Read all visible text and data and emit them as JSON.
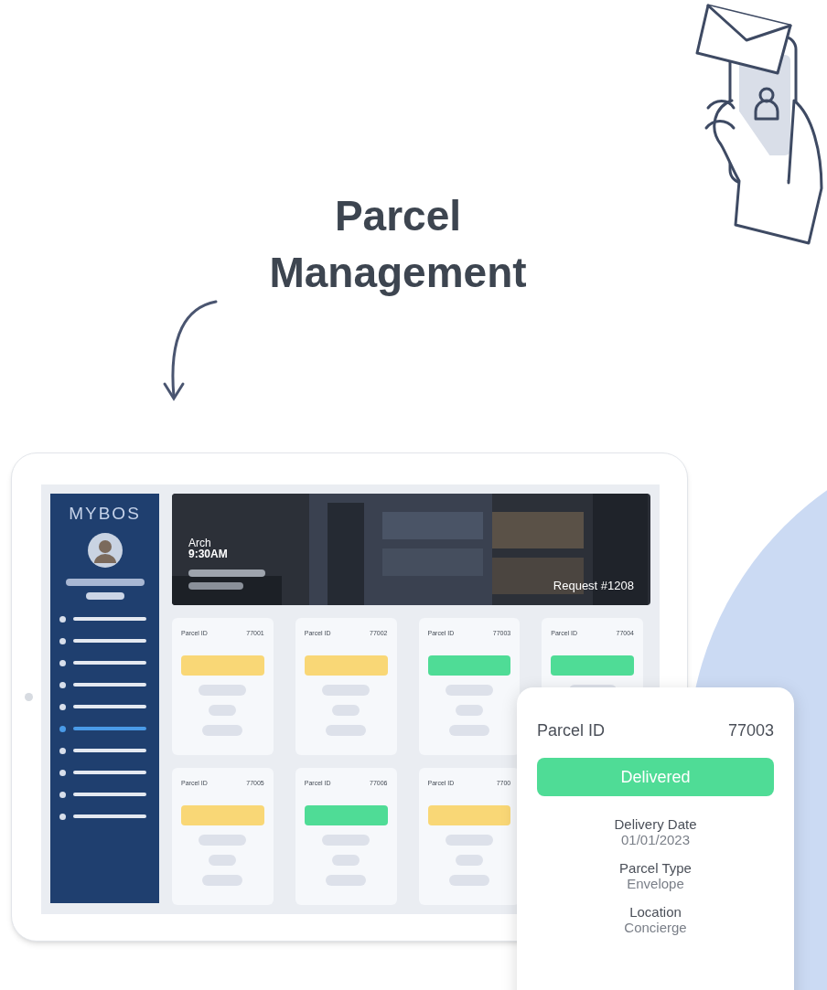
{
  "heading": "Parcel Management",
  "app": {
    "logo": "MYBOS",
    "nav_items": [
      {
        "selected": false
      },
      {
        "selected": false
      },
      {
        "selected": false
      },
      {
        "selected": false
      },
      {
        "selected": false
      },
      {
        "selected": true
      },
      {
        "selected": false
      },
      {
        "selected": false
      },
      {
        "selected": false
      },
      {
        "selected": false
      }
    ]
  },
  "banner": {
    "name": "Arch",
    "time": "9:30AM",
    "request": "Request #1208"
  },
  "parcels": [
    {
      "label": "Parcel ID",
      "id": "77001",
      "color": "#f9d776"
    },
    {
      "label": "Parcel ID",
      "id": "77002",
      "color": "#f9d776"
    },
    {
      "label": "Parcel ID",
      "id": "77003",
      "color": "#4fdc96"
    },
    {
      "label": "Parcel ID",
      "id": "77004",
      "color": "#4fdc96"
    },
    {
      "label": "Parcel ID",
      "id": "77005",
      "color": "#f9d776"
    },
    {
      "label": "Parcel ID",
      "id": "77006",
      "color": "#4fdc96"
    },
    {
      "label": "Parcel ID",
      "id": "7700",
      "color": "#f9d776"
    }
  ],
  "detail": {
    "label": "Parcel ID",
    "id": "77003",
    "status": "Delivered",
    "color": "#4fdc96",
    "fields": [
      {
        "label": "Delivery Date",
        "value": "01/01/2023"
      },
      {
        "label": "Parcel Type",
        "value": "Envelope"
      },
      {
        "label": "Location",
        "value": "Concierge"
      }
    ]
  }
}
